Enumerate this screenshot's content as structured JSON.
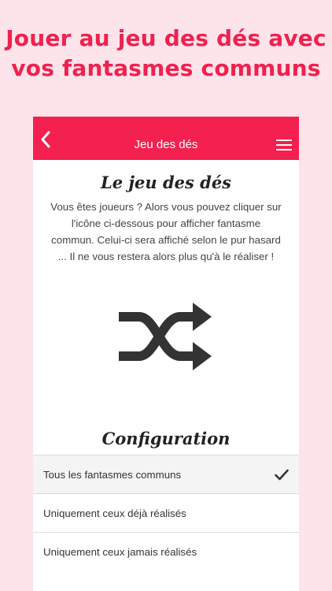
{
  "promo": {
    "line1": "Jouer au jeu des dés avec",
    "line2": "vos fantasmes communs"
  },
  "navbar": {
    "title": "Jeu des dés",
    "back_icon": "chevron-left-icon",
    "menu_icon": "hamburger-menu-icon"
  },
  "dice": {
    "title": "Le jeu des dés",
    "description": "Vous êtes joueurs ? Alors vous pouvez cliquer sur l'icône ci-dessous pour afficher fantasme commun. Celui-ci sera affiché selon le pur hasard ... Il ne vous restera alors plus qu'à le réaliser !",
    "shuffle_icon": "shuffle-icon"
  },
  "configuration": {
    "title": "Configuration",
    "options": [
      {
        "label": "Tous les fantasmes communs",
        "selected": true
      },
      {
        "label": "Uniquement ceux déjà réalisés",
        "selected": false
      },
      {
        "label": "Uniquement ceux jamais réalisés",
        "selected": false
      }
    ]
  },
  "colors": {
    "accent": "#f4204f",
    "promo_text": "#f0214f",
    "background": "#fce4ea"
  }
}
